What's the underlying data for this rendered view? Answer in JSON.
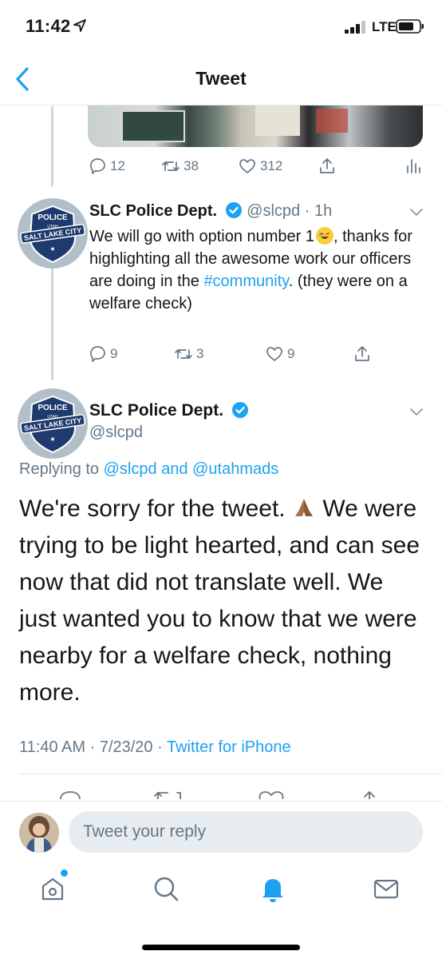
{
  "status_bar": {
    "time": "11:42",
    "carrier": "LTE"
  },
  "nav": {
    "title": "Tweet"
  },
  "prev_tweet_actions": {
    "replies": "12",
    "retweets": "38",
    "likes": "312"
  },
  "reply_tweet": {
    "name": "SLC Police Dept.",
    "handle": "@slcpd",
    "separator": "·",
    "time_ago": "1h",
    "text_1": "We will go with option number 1",
    "text_2": ", thanks for highlighting all the awesome work our officers are doing in the ",
    "hashtag": "#community",
    "text_3": ". (they were on a welfare check)",
    "replies": "9",
    "retweets": "3",
    "likes": "9"
  },
  "main_tweet": {
    "name": "SLC Police Dept.",
    "handle": "@slcpd",
    "replying_prefix": "Replying to",
    "replying_user1": "@slcpd",
    "replying_and": "and",
    "replying_user2": "@utahmads",
    "text_1": "We're sorry for the tweet.",
    "text_2": "We were trying to be light hearted, and can see now that did not translate well. We just wanted you to know that we were nearby for a welfare check, nothing more.",
    "time": "11:40 AM",
    "dot": "·",
    "date": "7/23/20",
    "source": "Twitter for iPhone"
  },
  "avatar": {
    "badge_top": "POLICE",
    "badge_state": "UTAH",
    "badge_city": "SALT LAKE CITY"
  },
  "composer": {
    "placeholder": "Tweet your reply"
  },
  "colors": {
    "accent": "#1da1f2",
    "secondary_text": "#657786",
    "divider": "#e1e8ed"
  },
  "icons": [
    "back-icon",
    "reply-icon",
    "retweet-icon",
    "like-icon",
    "share-icon",
    "analytics-icon",
    "verified-icon",
    "caret-down-icon",
    "home-icon",
    "search-icon",
    "notifications-icon",
    "messages-icon"
  ]
}
